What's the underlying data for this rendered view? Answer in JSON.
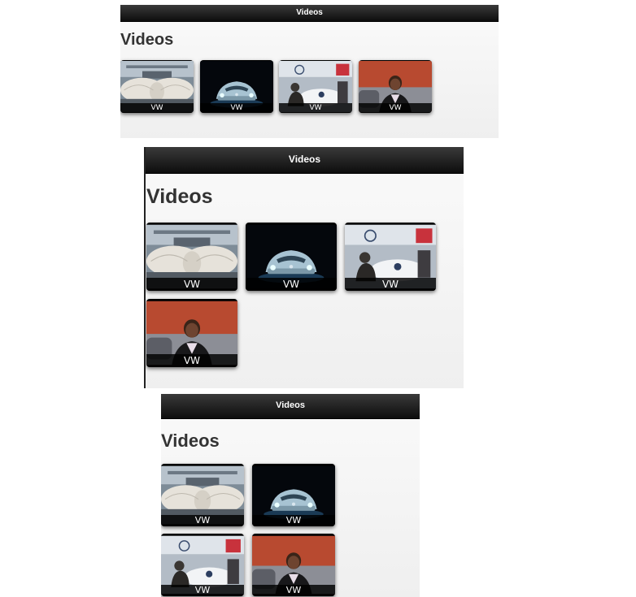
{
  "frames": [
    {
      "header_title": "Videos",
      "page_heading": "Videos",
      "videos": [
        {
          "caption": "VW",
          "scene": "angel-wings"
        },
        {
          "caption": "VW",
          "scene": "beetle-concept"
        },
        {
          "caption": "VW",
          "scene": "auto-show-booth"
        },
        {
          "caption": "VW",
          "scene": "presenter-woman"
        }
      ]
    },
    {
      "header_title": "Videos",
      "page_heading": "Videos",
      "videos": [
        {
          "caption": "VW",
          "scene": "angel-wings"
        },
        {
          "caption": "VW",
          "scene": "beetle-concept"
        },
        {
          "caption": "VW",
          "scene": "auto-show-booth"
        },
        {
          "caption": "VW",
          "scene": "presenter-woman"
        }
      ]
    },
    {
      "header_title": "Videos",
      "page_heading": "Videos",
      "videos": [
        {
          "caption": "VW",
          "scene": "angel-wings"
        },
        {
          "caption": "VW",
          "scene": "beetle-concept"
        },
        {
          "caption": "VW",
          "scene": "auto-show-booth"
        },
        {
          "caption": "VW",
          "scene": "presenter-woman"
        }
      ]
    }
  ],
  "colors": {
    "header_bar": "#1a1a1a",
    "caption_bar": "#000000",
    "heading_text": "#333333"
  }
}
